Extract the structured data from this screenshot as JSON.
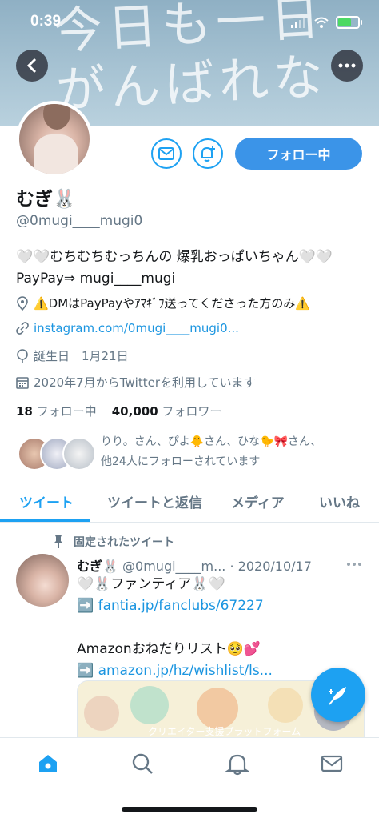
{
  "status_bar": {
    "time": "0:39"
  },
  "banner": {
    "art_line1": "今日も一日",
    "art_line2": "がんばれない"
  },
  "profile": {
    "name": "むぎ🐰",
    "handle": "@0mugi____mugi0",
    "bio_line1": "🤍🤍むちむちむっちんの 爆乳おっぱいちゃん🤍🤍",
    "bio_line2": "PayPay⇒ mugi____mugi",
    "location": "⚠️DMはPayPayやｱﾏｷﾞﾌ送ってくださった方のみ⚠️",
    "website": "instagram.com/0mugi____mugi0...",
    "birthday": "誕生日　1月21日",
    "joined": "2020年7月からTwitterを利用しています",
    "following_count": "18",
    "following_label": "フォロー中",
    "followers_count": "40,000",
    "followers_label": "フォロワー",
    "followed_by_line1": "りり。さん、ぴよ🐥さん、ひな🐤🎀さん、",
    "followed_by_line2": "他24人にフォローされています",
    "follow_button": "フォロー中"
  },
  "tabs": [
    {
      "label": "ツイート",
      "active": true
    },
    {
      "label": "ツイートと返信",
      "active": false
    },
    {
      "label": "メディア",
      "active": false
    },
    {
      "label": "いいね",
      "active": false
    }
  ],
  "pinned_tweet": {
    "pinned_label": "固定されたツイート",
    "name": "むぎ🐰",
    "handle": "@0mugi____m...",
    "date": "· 2020/10/17",
    "line1": "🤍🐰ファンティア🐰🤍",
    "line2_prefix": "➡️",
    "line2_link": "fantia.jp/fanclubs/67227",
    "line3": "Amazonおねだりリスト🥺💕",
    "line4_prefix": "➡️",
    "line4_link": "amazon.jp/hz/wishlist/ls...",
    "card_caption": "クリエイター支援プラットフォーム"
  },
  "colors": {
    "accent": "#1da1f2",
    "follow_button": "#3b94e8",
    "secondary_text": "#657786"
  },
  "icons": [
    "back-icon",
    "more-icon",
    "message-icon",
    "notification-add-icon",
    "location-icon",
    "link-icon",
    "birthday-icon",
    "calendar-icon",
    "pin-icon",
    "compose-icon",
    "home-icon",
    "search-icon",
    "bell-icon",
    "mail-icon"
  ]
}
